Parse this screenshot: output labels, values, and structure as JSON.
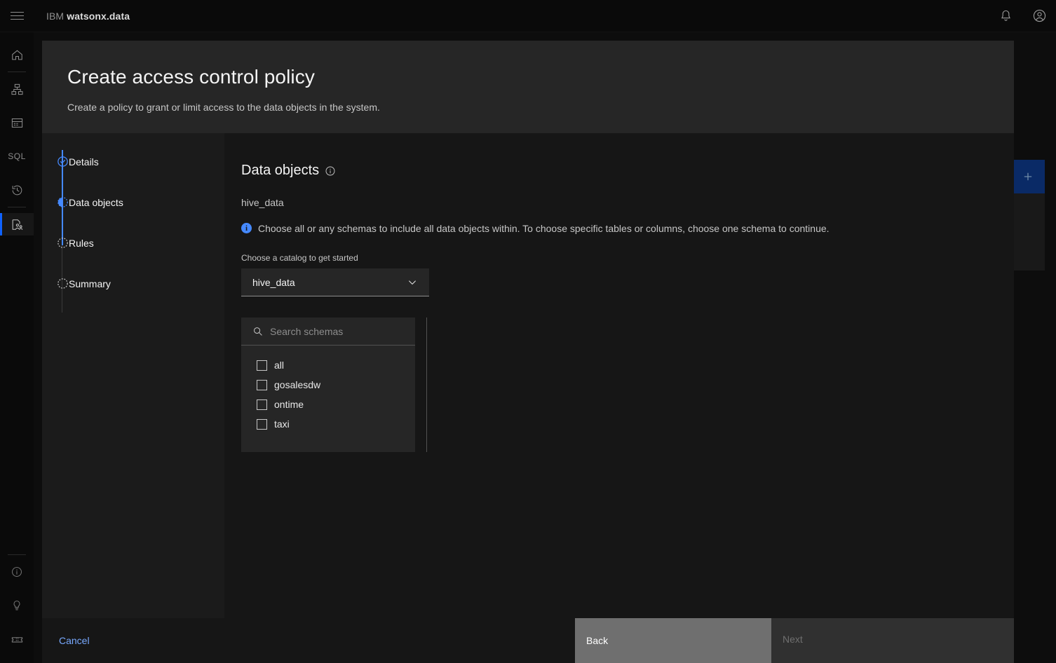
{
  "header": {
    "menu_icon": "hamburger-menu-icon",
    "brand_prefix": "IBM",
    "brand_name": "watsonx.data",
    "notifications_icon": "bell-icon",
    "account_icon": "user-avatar-icon"
  },
  "rail": {
    "items": [
      {
        "name": "home",
        "icon": "home-icon"
      },
      {
        "name": "infrastructure",
        "icon": "infrastructure-icon"
      },
      {
        "name": "data-manager",
        "icon": "data-table-icon"
      },
      {
        "name": "query-workspace",
        "icon": "sql-icon",
        "text": "SQL"
      },
      {
        "name": "query-history",
        "icon": "history-icon"
      },
      {
        "name": "access-control",
        "icon": "access-control-icon",
        "active": true
      }
    ],
    "bottom_items": [
      {
        "name": "about",
        "icon": "info-circle-icon"
      },
      {
        "name": "tips",
        "icon": "lightbulb-icon"
      },
      {
        "name": "labs",
        "icon": "ticket-icon"
      }
    ]
  },
  "background": {
    "add_button_icon": "plus-icon"
  },
  "modal": {
    "title": "Create access control policy",
    "subtitle": "Create a policy to grant or limit access to the data objects in the system.",
    "steps": [
      {
        "label": "Details",
        "state": "complete",
        "icon": "check-circle-icon"
      },
      {
        "label": "Data objects",
        "state": "current",
        "icon": "half-circle-icon"
      },
      {
        "label": "Rules",
        "state": "incomplete",
        "icon": "dotted-circle-icon"
      },
      {
        "label": "Summary",
        "state": "incomplete",
        "icon": "dotted-circle-icon"
      }
    ],
    "content": {
      "section_title": "Data objects",
      "section_info_icon": "info-circle-icon",
      "catalog_name": "hive_data",
      "hint_icon": "info-filled-icon",
      "hint_text": "Choose all or any schemas to include all data objects within. To choose specific tables or columns, choose one schema to continue.",
      "select_label": "Choose a catalog to get started",
      "select_value": "hive_data",
      "select_chevron_icon": "chevron-down-icon",
      "search_icon": "search-icon",
      "search_placeholder": "Search schemas",
      "search_value": "",
      "schemas": [
        {
          "label": "all",
          "checked": false
        },
        {
          "label": "gosalesdw",
          "checked": false
        },
        {
          "label": "ontime",
          "checked": false
        },
        {
          "label": "taxi",
          "checked": false
        }
      ]
    },
    "footer": {
      "cancel_label": "Cancel",
      "back_label": "Back",
      "next_label": "Next"
    }
  },
  "colors": {
    "accent_blue": "#0f62fe",
    "link_blue": "#78a9ff",
    "step_blue": "#4589ff",
    "modal_bg": "#161616",
    "modal_header_bg": "#262626",
    "back_button_bg": "#6f6f6f"
  }
}
